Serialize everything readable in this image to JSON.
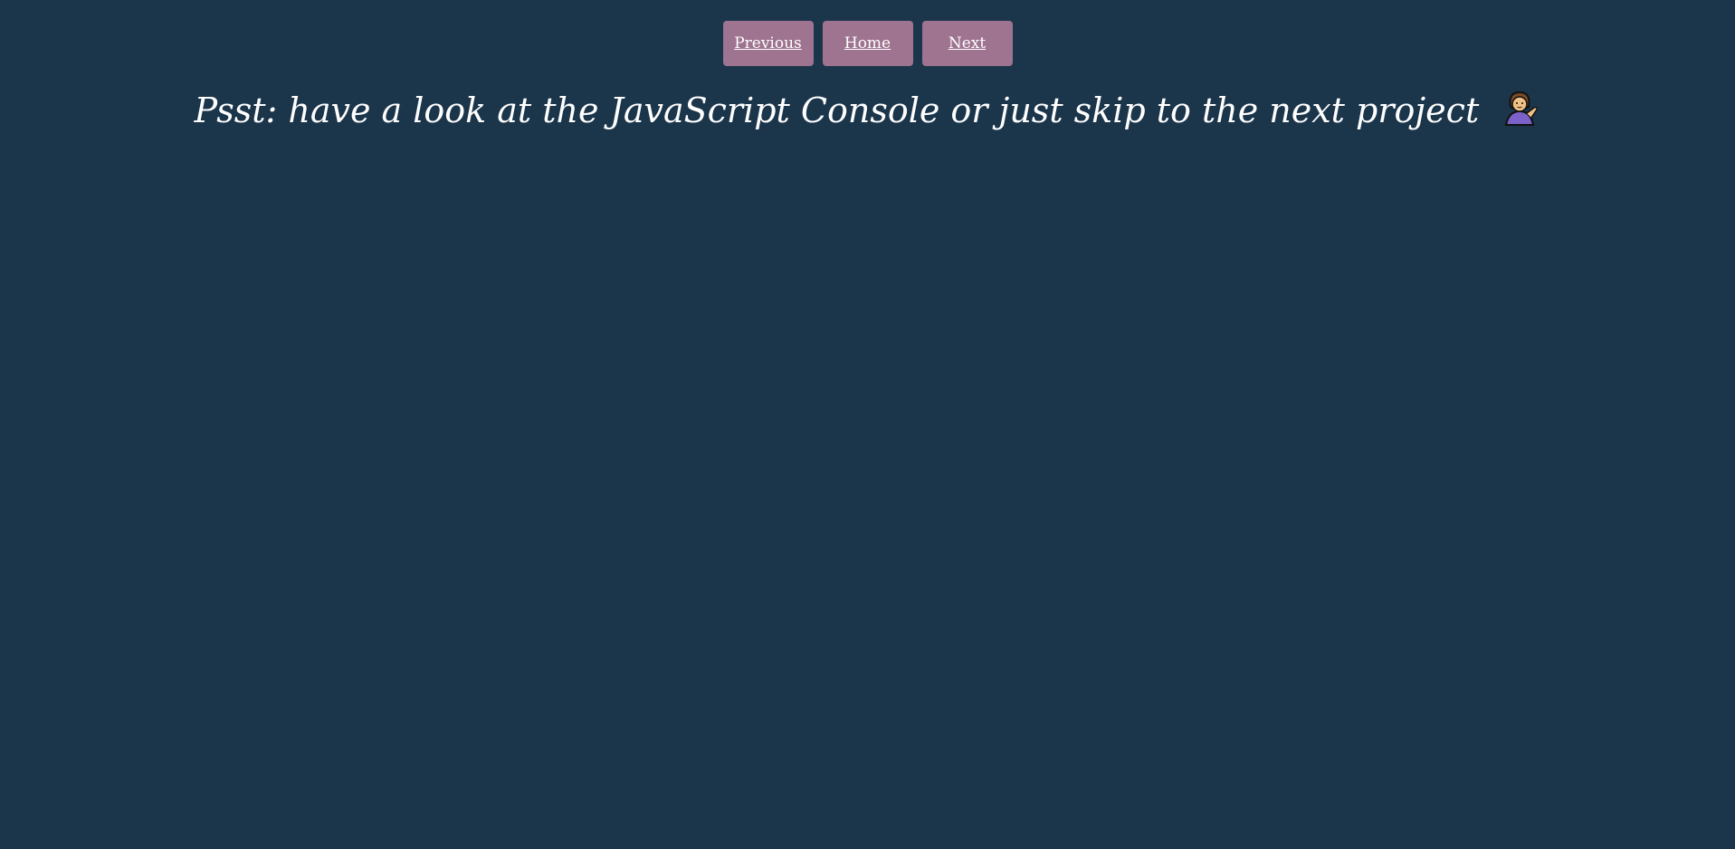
{
  "nav": {
    "previous_label": "Previous",
    "home_label": "Home",
    "next_label": "Next"
  },
  "message": {
    "text": "Psst: have a look at the JavaScript Console or just skip to the next project",
    "icon": "person-tipping-hand-icon"
  },
  "colors": {
    "background": "#1b354b",
    "button": "#9e7490",
    "text": "#ffffff"
  }
}
